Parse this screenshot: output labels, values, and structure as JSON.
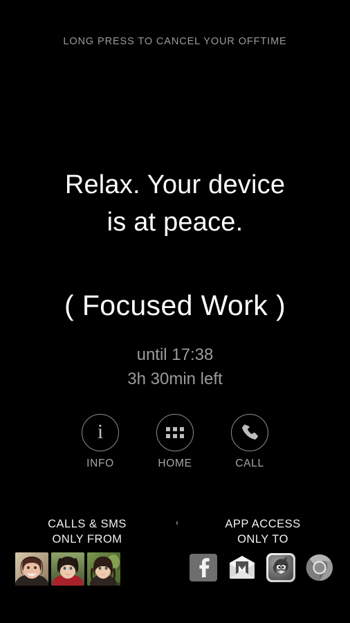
{
  "screen": {
    "background_color": "#000000",
    "hint": "LONG PRESS TO CANCEL YOUR OFFTIME"
  },
  "message": {
    "line1": "Relax. Your device",
    "line2": "is at peace."
  },
  "profile": {
    "name": "( Focused Work )",
    "until": "until 17:38",
    "remaining": "3h 30min left"
  },
  "actions": [
    {
      "icon": "info-icon",
      "label": "INFO"
    },
    {
      "icon": "home-grid-icon",
      "label": "HOME"
    },
    {
      "icon": "phone-icon",
      "label": "CALL"
    }
  ],
  "footer": {
    "contacts_section": {
      "title_line1": "CALLS & SMS",
      "title_line2": "ONLY FROM",
      "contacts": [
        {
          "name": "contact-avatar-1"
        },
        {
          "name": "contact-avatar-2"
        },
        {
          "name": "contact-avatar-3"
        }
      ]
    },
    "apps_section": {
      "title_line1": "APP ACCESS",
      "title_line2": "ONLY TO",
      "apps": [
        {
          "name": "facebook-icon",
          "label": "Facebook"
        },
        {
          "name": "gmail-icon",
          "label": "Gmail"
        },
        {
          "name": "angry-birds-icon",
          "label": "Angry Birds"
        },
        {
          "name": "chrome-icon",
          "label": "Chrome"
        }
      ]
    }
  },
  "colors": {
    "background": "#000000",
    "primary_text": "#ffffff",
    "secondary_text": "#9c9c9c",
    "icon_stroke": "#8e8e8e"
  }
}
